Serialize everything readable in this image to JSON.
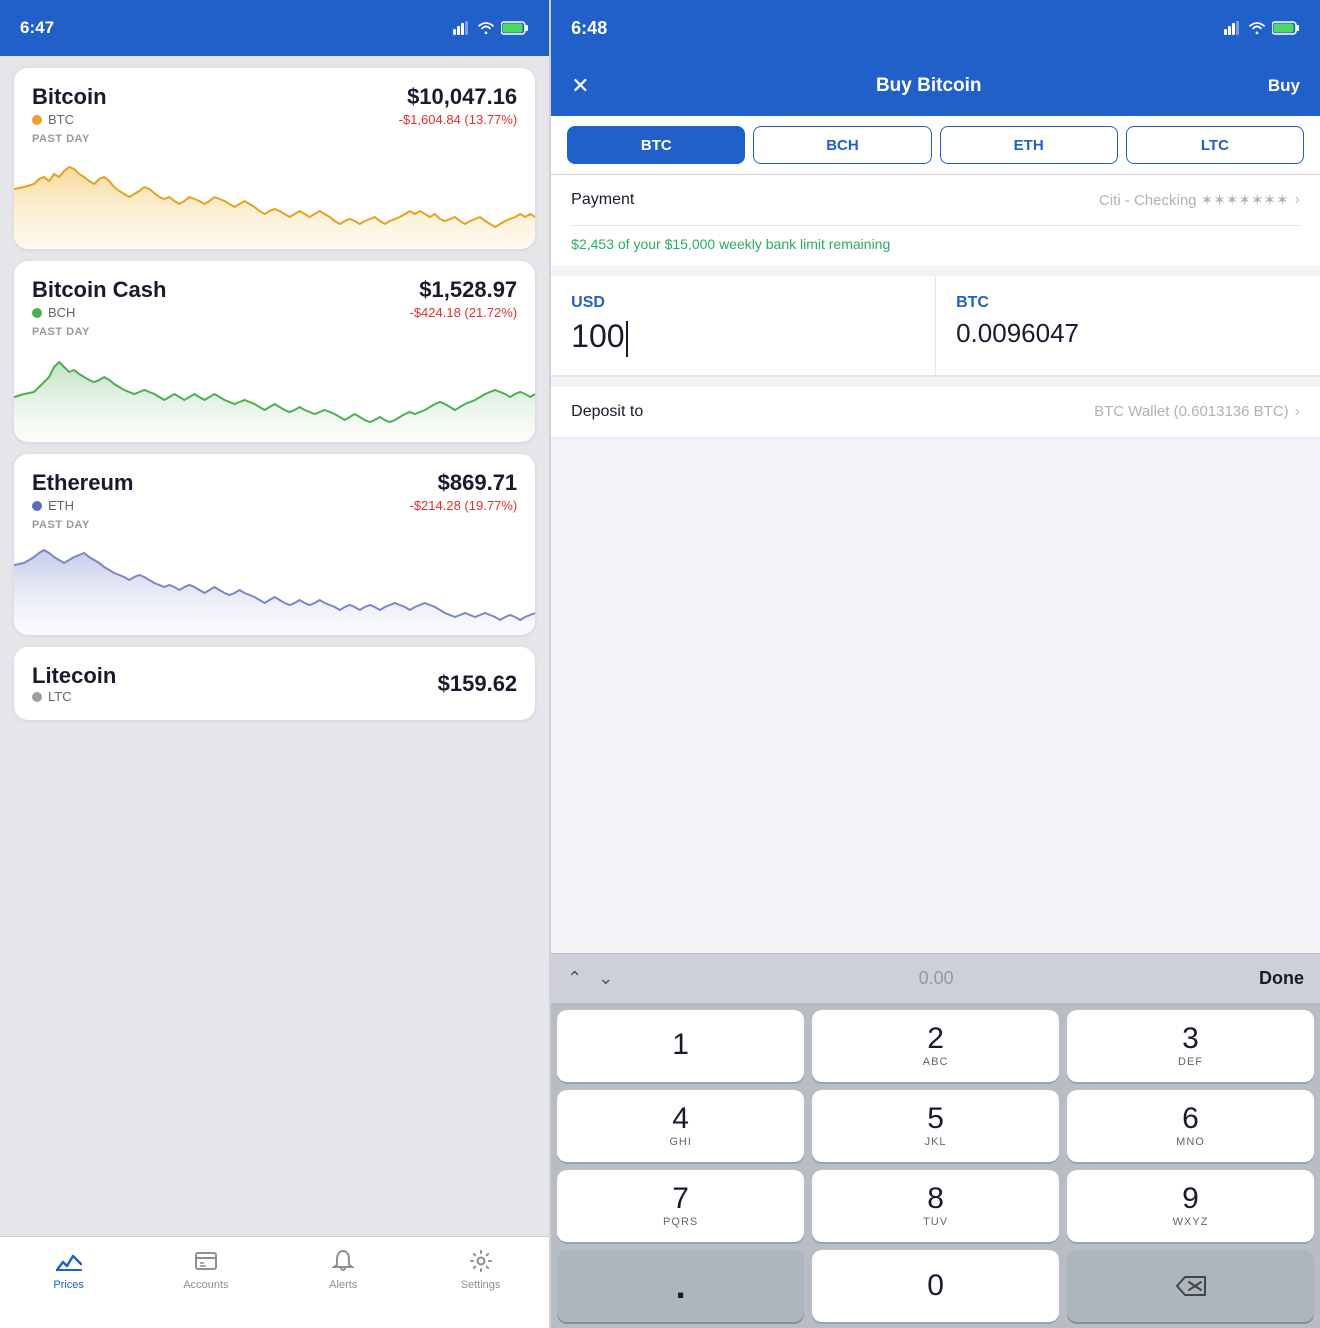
{
  "left": {
    "status": {
      "time": "6:47",
      "has_location": true
    },
    "coins": [
      {
        "name": "Bitcoin",
        "ticker": "BTC",
        "dot_color": "#f0a030",
        "price": "$10,047.16",
        "change": "-$1,604.84 (13.77%)",
        "period": "PAST DAY",
        "chart_color": "#e8a020",
        "chart_bg": "#fdf0d0",
        "id": "btc"
      },
      {
        "name": "Bitcoin Cash",
        "ticker": "BCH",
        "dot_color": "#4caf50",
        "price": "$1,528.97",
        "change": "-$424.18 (21.72%)",
        "period": "PAST DAY",
        "chart_color": "#4caf50",
        "chart_bg": "#e8f5e9",
        "id": "bch"
      },
      {
        "name": "Ethereum",
        "ticker": "ETH",
        "dot_color": "#5c6bc0",
        "price": "$869.71",
        "change": "-$214.28 (19.77%)",
        "period": "PAST DAY",
        "chart_color": "#7986cb",
        "chart_bg": "#e8eaf6",
        "id": "eth"
      }
    ],
    "litecoin": {
      "name": "Litecoin",
      "ticker": "LTC",
      "dot_color": "#9e9e9e",
      "price": "$159.62",
      "change": ""
    },
    "tabs": [
      {
        "label": "Prices",
        "active": true
      },
      {
        "label": "Accounts",
        "active": false
      },
      {
        "label": "Alerts",
        "active": false
      },
      {
        "label": "Settings",
        "active": false
      }
    ]
  },
  "right": {
    "status": {
      "time": "6:48",
      "has_location": true
    },
    "nav": {
      "title": "Buy Bitcoin",
      "buy_label": "Buy",
      "close_icon": "✕"
    },
    "crypto_tabs": [
      {
        "label": "BTC",
        "active": true
      },
      {
        "label": "BCH",
        "active": false
      },
      {
        "label": "ETH",
        "active": false
      },
      {
        "label": "LTC",
        "active": false
      }
    ],
    "payment": {
      "label": "Payment",
      "value": "Citi - Checking ✶✶✶✶✶✶✶"
    },
    "limit_text": "$2,453 of your $15,000 weekly bank limit remaining",
    "usd": {
      "currency": "USD",
      "value": "100"
    },
    "btc": {
      "currency": "BTC",
      "value": "0.0096047"
    },
    "deposit": {
      "label": "Deposit to",
      "value": "BTC Wallet (0.6013136 BTC)"
    },
    "keyboard": {
      "toolbar_display": "0.00",
      "done_label": "Done",
      "keys": [
        {
          "num": "1",
          "alpha": ""
        },
        {
          "num": "2",
          "alpha": "ABC"
        },
        {
          "num": "3",
          "alpha": "DEF"
        },
        {
          "num": "4",
          "alpha": "GHI"
        },
        {
          "num": "5",
          "alpha": "JKL"
        },
        {
          "num": "6",
          "alpha": "MNO"
        },
        {
          "num": "7",
          "alpha": "PQRS"
        },
        {
          "num": "8",
          "alpha": "TUV"
        },
        {
          "num": "9",
          "alpha": "WXYZ"
        }
      ]
    }
  }
}
